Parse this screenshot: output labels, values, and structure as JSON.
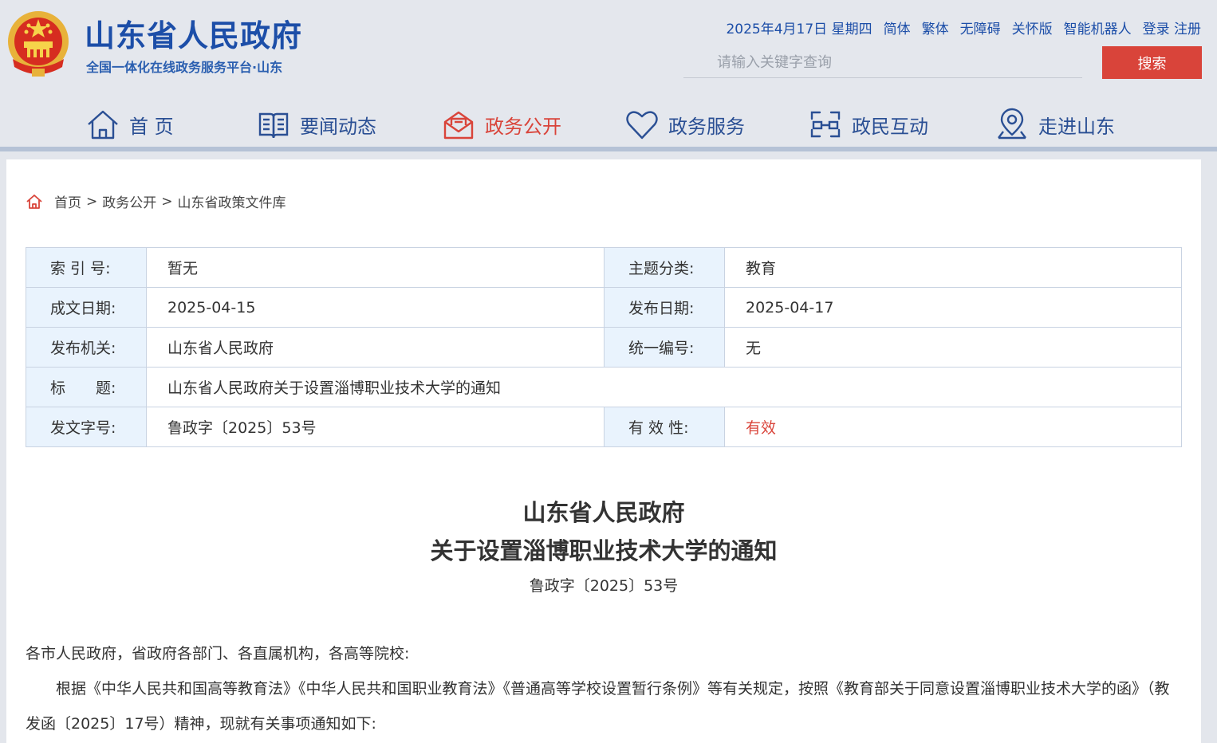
{
  "header": {
    "site_title": "山东省人民政府",
    "site_subtitle": "全国一体化在线政务服务平台·山东",
    "top_links": {
      "date": "2025年4月17日 星期四",
      "simplified": "简体",
      "traditional": "繁体",
      "accessibility": "无障碍",
      "care_mode": "关怀版",
      "robot": "智能机器人",
      "login": "登录",
      "register": "注册"
    },
    "search": {
      "placeholder": "请输入关键字查询",
      "button": "搜索"
    }
  },
  "nav": {
    "items": [
      {
        "label": "首 页",
        "icon": "home-icon"
      },
      {
        "label": "要闻动态",
        "icon": "book-icon"
      },
      {
        "label": "政务公开",
        "icon": "mail-open-icon",
        "active": true
      },
      {
        "label": "政务服务",
        "icon": "heart-icon"
      },
      {
        "label": "政民互动",
        "icon": "interaction-icon"
      },
      {
        "label": "走进山东",
        "icon": "location-pin-icon"
      }
    ],
    "active_color": "#d9443a",
    "color": "#2a4f94"
  },
  "breadcrumb": {
    "items": [
      "首页",
      "政务公开",
      "山东省政策文件库"
    ],
    "separator": ">"
  },
  "meta": {
    "index_label": "索 引 号:",
    "index_value": "暂无",
    "topic_label": "主题分类:",
    "topic_value": "教育",
    "written_label": "成文日期:",
    "written_value": "2025-04-15",
    "published_label": "发布日期:",
    "published_value": "2025-04-17",
    "issuer_label": "发布机关:",
    "issuer_value": "山东省人民政府",
    "serial_label": "统一编号:",
    "serial_value": "无",
    "title_label": "标　　题:",
    "title_value": "山东省人民政府关于设置淄博职业技术大学的通知",
    "docno_label": "发文字号:",
    "docno_value": "鲁政字〔2025〕53号",
    "validity_label": "有 效 性:",
    "validity_value": "有效"
  },
  "document": {
    "title_line1": "山东省人民政府",
    "title_line2": "关于设置淄博职业技术大学的通知",
    "doc_number": "鲁政字〔2025〕53号",
    "salutation": "各市人民政府，省政府各部门、各直属机构，各高等院校:",
    "body_para1": "　　根据《中华人民共和国高等教育法》《中华人民共和国职业教育法》《普通高等学校设置暂行条例》等有关规定，按照《教育部关于同意设置淄博职业技术大学的函》（教发函〔2025〕17号）精神，现就有关事项通知如下:"
  },
  "colors": {
    "brand_blue": "#1c4ea8",
    "accent_red": "#d9443a",
    "label_bg": "#e9f3fd"
  }
}
